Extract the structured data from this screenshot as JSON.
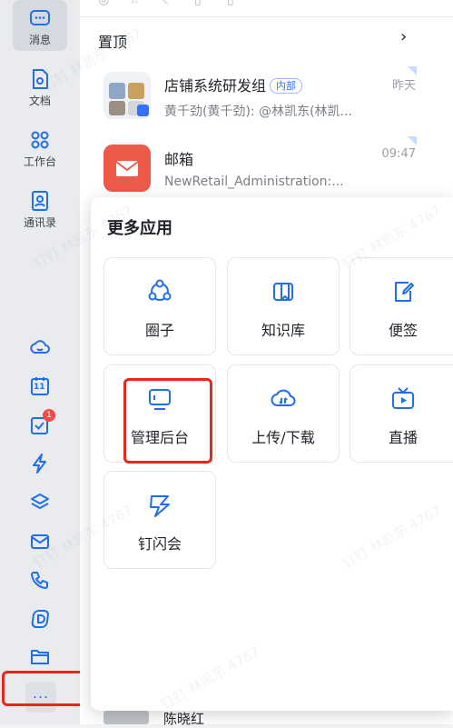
{
  "sidebar": {
    "nav": [
      {
        "label": "消息"
      },
      {
        "label": "文档"
      },
      {
        "label": "工作台"
      },
      {
        "label": "通讯录"
      }
    ],
    "tools": [
      "cloud-icon",
      "calendar-icon",
      "todo-icon",
      "lightning-icon",
      "cube-icon",
      "mail-icon",
      "phone-icon",
      "d-icon",
      "folder-icon"
    ],
    "calendar_day": "11",
    "todo_badge": "1",
    "more_label": "..."
  },
  "chat": {
    "pinned_label": "置顶",
    "items": [
      {
        "name": "店铺系统研发组",
        "tag": "内部",
        "preview": "黄千劲(黄千劲): @林凯东(林凯...",
        "time": "昨天"
      },
      {
        "name": "邮箱",
        "preview": "NewRetail_Administration:...",
        "time": "09:47"
      }
    ]
  },
  "popup": {
    "title": "更多应用",
    "apps": [
      {
        "label": "圈子",
        "icon": "circle-group-icon"
      },
      {
        "label": "知识库",
        "icon": "book-icon"
      },
      {
        "label": "便签",
        "icon": "note-icon"
      },
      {
        "label": "管理后台",
        "icon": "monitor-icon"
      },
      {
        "label": "上传/下载",
        "icon": "cloud-transfer-icon"
      },
      {
        "label": "直播",
        "icon": "tv-icon"
      },
      {
        "label": "钉闪会",
        "icon": "lightning-icon"
      }
    ]
  },
  "watermark": "钉钉 林凯东 4767",
  "colors": {
    "accent": "#1f6feb",
    "highlight": "#e8261c",
    "badge": "#f54a45"
  }
}
